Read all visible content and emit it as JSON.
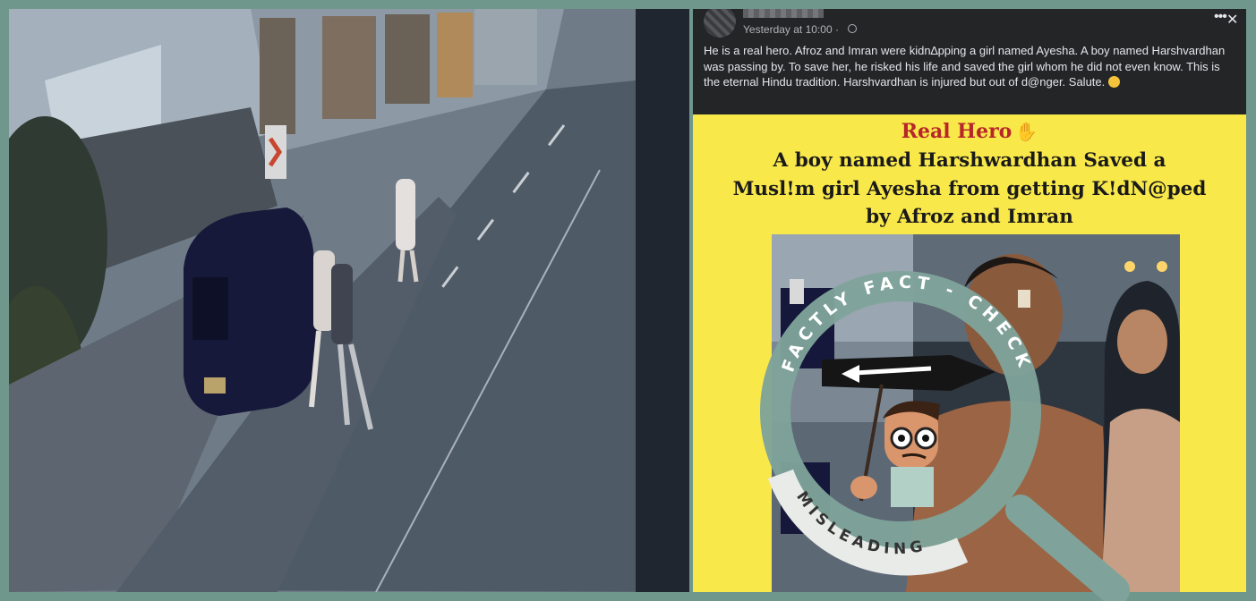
{
  "post": {
    "timestamp": "Yesterday at 10:00 ·",
    "text": "He is a real hero. Afroz and Imran were kidn∆pping a girl named Ayesha. A boy named Harshvardhan was passing by. To save her, he risked his life and saved the girl whom he did not even know. This is the eternal Hindu tradition. Harshvardhan is injured but out of d@nger. Salute.",
    "more_label": "•••",
    "close_label": "✕"
  },
  "card": {
    "title": "Real Hero",
    "headline": "A boy named Harshwardhan Saved a Musl!m girl Ayesha from getting K!dN@ped by Afroz and Imran"
  },
  "stamp": {
    "brand": "FACTLY FACT - CHECK",
    "verdict": "MISLEADING"
  },
  "colors": {
    "frame": "#6f978c",
    "seal": "#7fa39a",
    "card_bg": "#f9e84a",
    "title_red": "#b7272a"
  },
  "icons": {
    "globe": "globe-icon",
    "more": "more-options-icon",
    "close": "close-icon",
    "raised_hands": "raised-hands-emoji-icon",
    "magnifier": "magnifying-glass-icon"
  }
}
